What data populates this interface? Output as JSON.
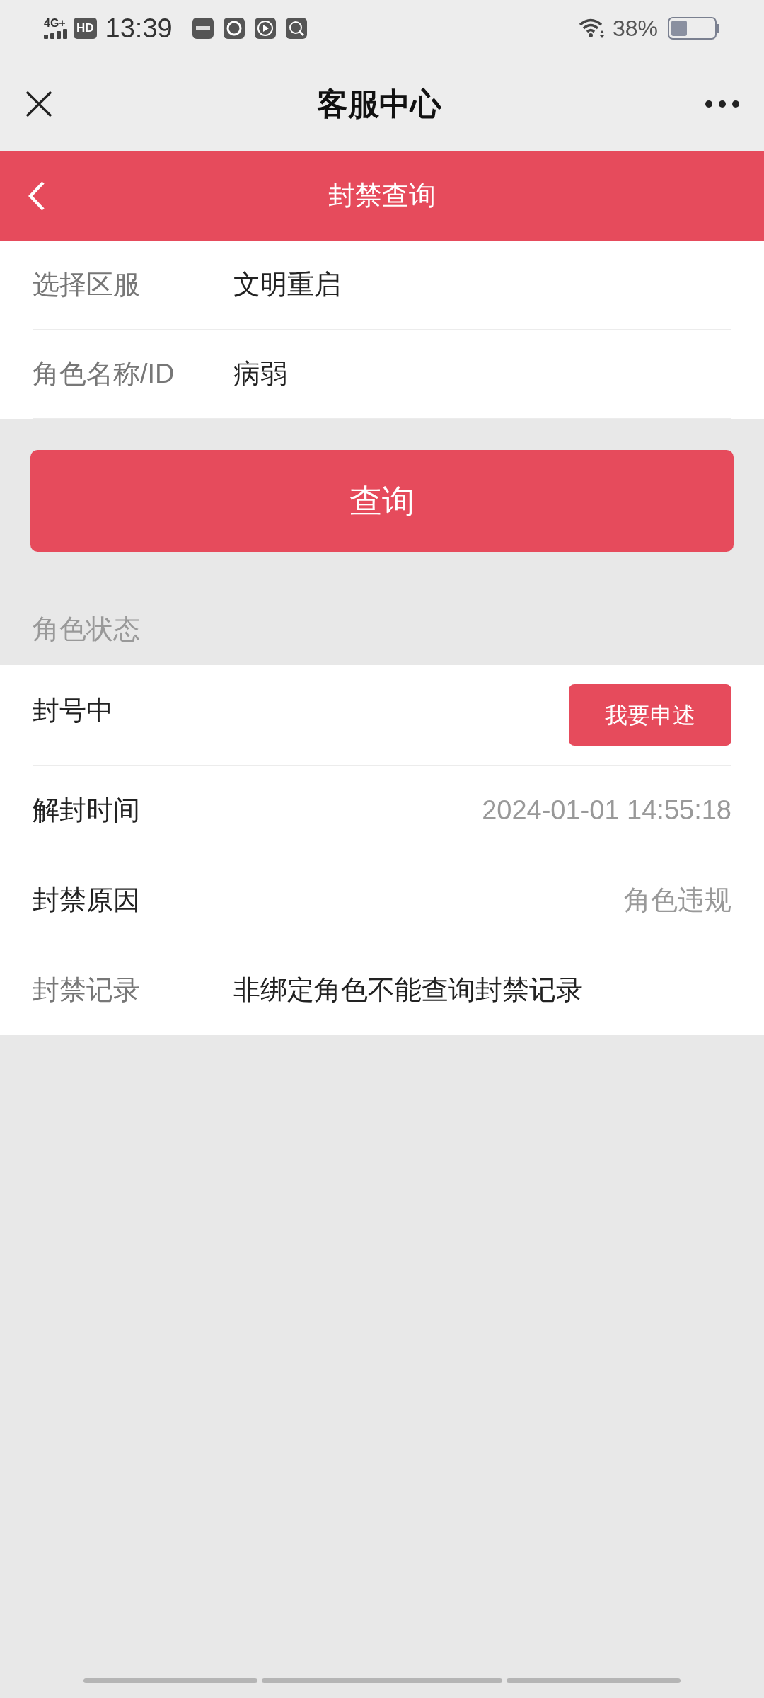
{
  "status_bar": {
    "network": "4G+",
    "hd": "HD",
    "time": "13:39",
    "battery": "38%"
  },
  "title_bar": {
    "title": "客服中心"
  },
  "header": {
    "title": "封禁查询"
  },
  "form": [
    {
      "label": "选择区服",
      "value": "文明重启"
    },
    {
      "label": "角色名称/ID",
      "value": "病弱"
    }
  ],
  "query_button": "查询",
  "section_title": "角色状态",
  "status": {
    "label": "封号中",
    "button": "我要申述"
  },
  "details": [
    {
      "label": "解封时间",
      "value": "2024-01-01 14:55:18"
    },
    {
      "label": "封禁原因",
      "value": "角色违规"
    }
  ],
  "record": {
    "label": "封禁记录",
    "value": "非绑定角色不能查询封禁记录"
  }
}
